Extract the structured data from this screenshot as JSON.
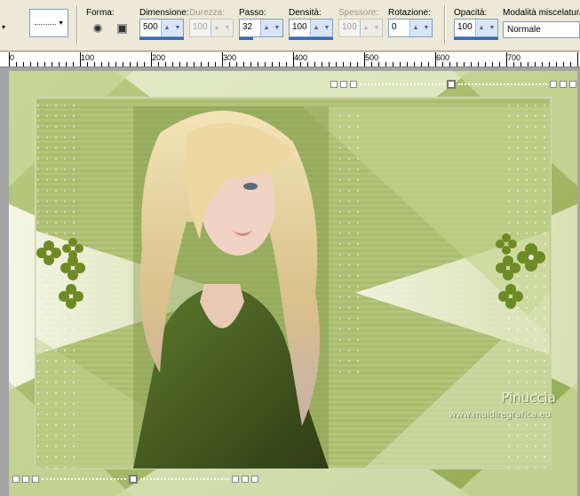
{
  "toolbar": {
    "shape_label": "Forma:",
    "size_label": "Dimensione:",
    "size_value": "500",
    "hardness_label": "Durezza:",
    "hardness_value": "100",
    "step_label": "Passo:",
    "step_value": "32",
    "density_label": "Densità:",
    "density_value": "100",
    "thickness_label": "Spessore:",
    "thickness_value": "100",
    "rotation_label": "Rotazione:",
    "rotation_value": "0",
    "opacity_label": "Opacità:",
    "opacity_value": "100",
    "blend_label": "Modalità miscelatura:",
    "blend_value": "Normale"
  },
  "ruler": {
    "labels": [
      "0",
      "100",
      "200",
      "300",
      "400",
      "500",
      "600",
      "700"
    ]
  },
  "canvas": {
    "watermark_name": "Pinuccia",
    "watermark_url": "www.maidiregrafica.eu"
  },
  "colors": {
    "toolbar_bg": "#ece9d8",
    "canvas_green": "#a3b865",
    "canvas_light": "#eef0d6",
    "accent_blue": "#316ac5"
  },
  "icons": {
    "round_shape": "round-brush-icon",
    "square_shape": "square-brush-icon"
  }
}
